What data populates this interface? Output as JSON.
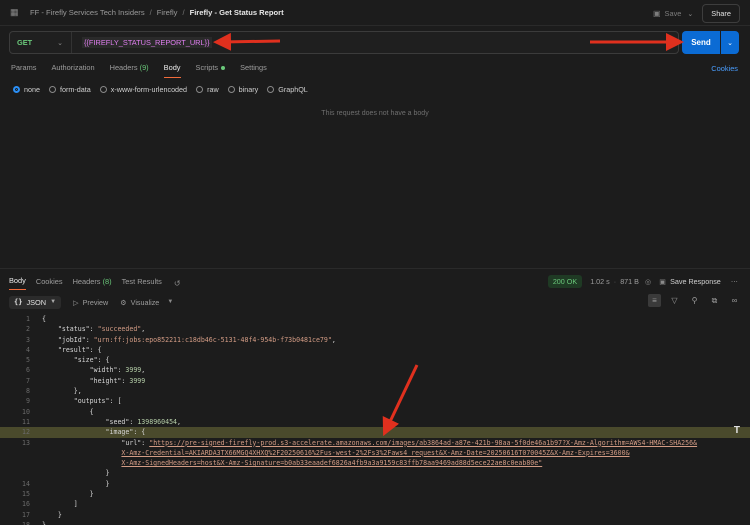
{
  "breadcrumb": {
    "items": [
      "FF - Firefly Services Tech Insiders",
      "Firefly"
    ],
    "current": "Firefly - Get Status Report"
  },
  "header": {
    "save_label": "Save",
    "share_label": "Share"
  },
  "request": {
    "method": "GET",
    "url": "{{FIREFLY_STATUS_REPORT_URL}}",
    "send_label": "Send"
  },
  "request_tabs": [
    {
      "label": "Params"
    },
    {
      "label": "Authorization"
    },
    {
      "label": "Headers",
      "count": "(9)"
    },
    {
      "label": "Body",
      "active": true
    },
    {
      "label": "Scripts",
      "dot": true
    },
    {
      "label": "Settings"
    }
  ],
  "cookies_label": "Cookies",
  "body_types": [
    "none",
    "form-data",
    "x-www-form-urlencoded",
    "raw",
    "binary",
    "GraphQL"
  ],
  "body_selected": "none",
  "no_body_text": "This request does not have a body",
  "response_tabs": [
    {
      "label": "Body",
      "active": true
    },
    {
      "label": "Cookies"
    },
    {
      "label": "Headers",
      "count": "(8)"
    },
    {
      "label": "Test Results"
    }
  ],
  "response_meta": {
    "status": "200 OK",
    "time": "1.02 s",
    "size": "871 B",
    "save_response_label": "Save Response"
  },
  "response_toolbar": {
    "format_icon": "{}",
    "format": "JSON",
    "preview_label": "Preview",
    "visualize_label": "Visualize"
  },
  "code_lines": [
    {
      "n": "1",
      "parts": [
        [
          "k",
          "{"
        ]
      ]
    },
    {
      "n": "2",
      "parts": [
        [
          "k",
          "    "
        ],
        [
          "k",
          "\"status\""
        ],
        [
          "k",
          ": "
        ],
        [
          "s",
          "\"succeeded\""
        ],
        [
          "k",
          ","
        ]
      ]
    },
    {
      "n": "3",
      "parts": [
        [
          "k",
          "    "
        ],
        [
          "k",
          "\"jobId\""
        ],
        [
          "k",
          ": "
        ],
        [
          "s",
          "\"urn:ff:jobs:epo852211:c18db46c-5131-48f4-954b-f73b0481ce79\""
        ],
        [
          "k",
          ","
        ]
      ]
    },
    {
      "n": "4",
      "parts": [
        [
          "k",
          "    "
        ],
        [
          "k",
          "\"result\""
        ],
        [
          "k",
          ": {"
        ]
      ]
    },
    {
      "n": "5",
      "parts": [
        [
          "k",
          "        "
        ],
        [
          "k",
          "\"size\""
        ],
        [
          "k",
          ": {"
        ]
      ]
    },
    {
      "n": "6",
      "parts": [
        [
          "k",
          "            "
        ],
        [
          "k",
          "\"width\""
        ],
        [
          "k",
          ": "
        ],
        [
          "n",
          "3999"
        ],
        [
          "k",
          ","
        ]
      ]
    },
    {
      "n": "7",
      "parts": [
        [
          "k",
          "            "
        ],
        [
          "k",
          "\"height\""
        ],
        [
          "k",
          ": "
        ],
        [
          "n",
          "3999"
        ]
      ]
    },
    {
      "n": "8",
      "parts": [
        [
          "k",
          "        },"
        ]
      ]
    },
    {
      "n": "9",
      "parts": [
        [
          "k",
          "        "
        ],
        [
          "k",
          "\"outputs\""
        ],
        [
          "k",
          ": ["
        ]
      ]
    },
    {
      "n": "10",
      "parts": [
        [
          "k",
          "            {"
        ]
      ]
    },
    {
      "n": "11",
      "parts": [
        [
          "k",
          "                "
        ],
        [
          "k",
          "\"seed\""
        ],
        [
          "k",
          ": "
        ],
        [
          "n",
          "1398960454"
        ],
        [
          "k",
          ","
        ]
      ]
    },
    {
      "n": "12",
      "hl": true,
      "parts": [
        [
          "k",
          "                "
        ],
        [
          "k",
          "\"image\""
        ],
        [
          "k",
          ": "
        ],
        [
          "k",
          "{"
        ]
      ]
    },
    {
      "n": "13",
      "parts": [
        [
          "k",
          "                    "
        ],
        [
          "k",
          "\"url\""
        ],
        [
          "k",
          ": "
        ],
        [
          "u",
          "\"https://pre-signed-firefly-prod.s3-accelerate.amazonaws.com/images/ab3864ad-a87e-421b-98aa-5f0de46a1b97?X-Amz-Algorithm=AWS4-HMAC-SHA256&"
        ]
      ]
    },
    {
      "n": "",
      "parts": [
        [
          "k",
          "                    "
        ],
        [
          "u",
          "X-Amz-Credential=AKIARDA3TX66MGQ4XHXQ%2F20250616%2Fus-west-2%2Fs3%2Faws4_request&X-Amz-Date=20250616T070045Z&X-Amz-Expires=3600&"
        ]
      ]
    },
    {
      "n": "",
      "parts": [
        [
          "k",
          "                    "
        ],
        [
          "u",
          "X-Amz-SignedHeaders=host&X-Amz-Signature=b0ab33eaadef6826a4fb9a3a9159c83ffb78aa9469ad88d5ece22ae8c0eab80e\""
        ]
      ]
    },
    {
      "n": "",
      "parts": [
        [
          "k",
          "                "
        ],
        [
          "k",
          "}"
        ]
      ]
    },
    {
      "n": "14",
      "parts": [
        [
          "k",
          "                "
        ],
        [
          "k",
          "}"
        ]
      ]
    },
    {
      "n": "15",
      "parts": [
        [
          "k",
          "            }"
        ]
      ]
    },
    {
      "n": "16",
      "parts": [
        [
          "k",
          "        ]"
        ]
      ]
    },
    {
      "n": "17",
      "parts": [
        [
          "k",
          "    }"
        ]
      ]
    },
    {
      "n": "18",
      "parts": [
        [
          "k",
          "}"
        ]
      ]
    }
  ],
  "scroll_marker": "T",
  "colors": {
    "send_button": "#0b6bd4",
    "accent_tab": "#f26b3a",
    "status_ok": "#6ac87a",
    "variable_text": "#e07ef0",
    "annotation_arrow": "#e0301e"
  }
}
